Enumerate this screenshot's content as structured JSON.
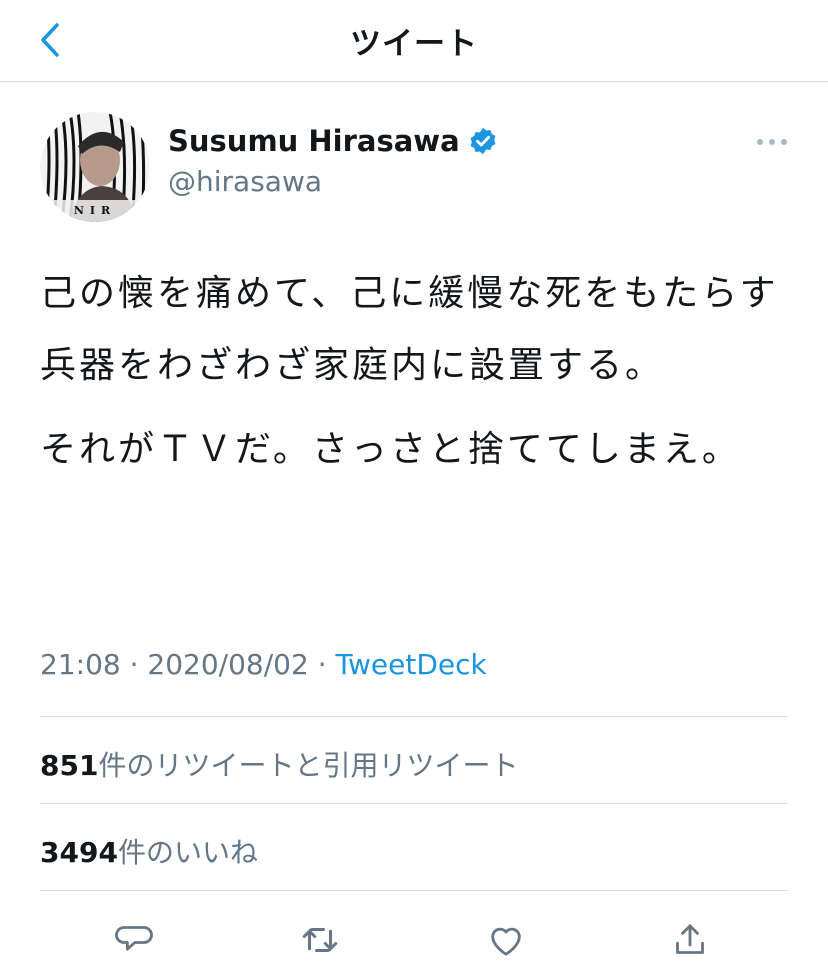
{
  "header": {
    "title": "ツイート",
    "back_icon": "chevron-left-icon"
  },
  "user": {
    "name": "Susumu Hirasawa",
    "handle": "@hirasawa",
    "verified_icon": "verified-badge-icon",
    "avatar_caption": "NIR"
  },
  "tweet": {
    "paragraphs": [
      "己の懐を痛めて、己に緩慢な死をもたらす兵器をわざわざ家庭内に設置する。",
      "それがＴＶだ。さっさと捨ててしまえ。"
    ],
    "time": "21:08",
    "separator": "·",
    "date": "2020/08/02",
    "source": "TweetDeck"
  },
  "stats": {
    "retweets_count": "851",
    "retweets_label": "件のリツイートと引用リツイート",
    "likes_count": "3494",
    "likes_label": "件のいいね"
  },
  "actions": [
    "reply-icon",
    "retweet-icon",
    "like-icon",
    "share-icon"
  ],
  "colors": {
    "accent": "#1b95e0",
    "text": "#14171a",
    "muted": "#657786",
    "divider": "#dcdcdc"
  }
}
